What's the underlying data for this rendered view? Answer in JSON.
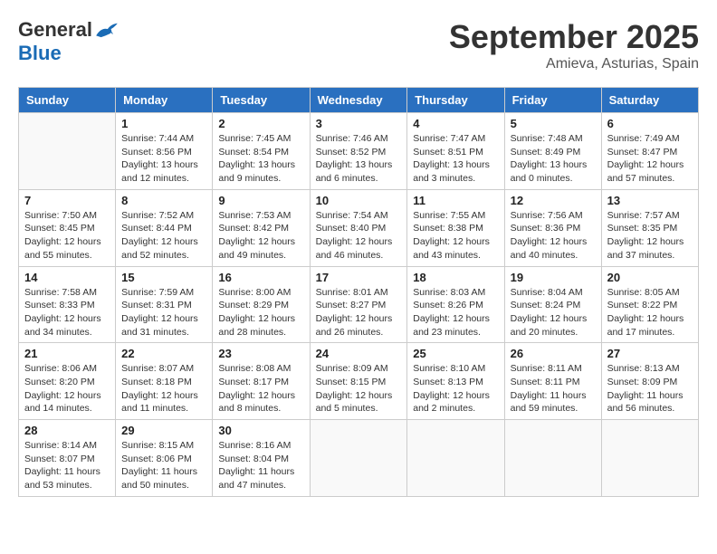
{
  "logo": {
    "general": "General",
    "blue": "Blue"
  },
  "title": "September 2025",
  "subtitle": "Amieva, Asturias, Spain",
  "weekdays": [
    "Sunday",
    "Monday",
    "Tuesday",
    "Wednesday",
    "Thursday",
    "Friday",
    "Saturday"
  ],
  "weeks": [
    [
      {
        "day": "",
        "sunrise": "",
        "sunset": "",
        "daylight": ""
      },
      {
        "day": "1",
        "sunrise": "Sunrise: 7:44 AM",
        "sunset": "Sunset: 8:56 PM",
        "daylight": "Daylight: 13 hours and 12 minutes."
      },
      {
        "day": "2",
        "sunrise": "Sunrise: 7:45 AM",
        "sunset": "Sunset: 8:54 PM",
        "daylight": "Daylight: 13 hours and 9 minutes."
      },
      {
        "day": "3",
        "sunrise": "Sunrise: 7:46 AM",
        "sunset": "Sunset: 8:52 PM",
        "daylight": "Daylight: 13 hours and 6 minutes."
      },
      {
        "day": "4",
        "sunrise": "Sunrise: 7:47 AM",
        "sunset": "Sunset: 8:51 PM",
        "daylight": "Daylight: 13 hours and 3 minutes."
      },
      {
        "day": "5",
        "sunrise": "Sunrise: 7:48 AM",
        "sunset": "Sunset: 8:49 PM",
        "daylight": "Daylight: 13 hours and 0 minutes."
      },
      {
        "day": "6",
        "sunrise": "Sunrise: 7:49 AM",
        "sunset": "Sunset: 8:47 PM",
        "daylight": "Daylight: 12 hours and 57 minutes."
      }
    ],
    [
      {
        "day": "7",
        "sunrise": "Sunrise: 7:50 AM",
        "sunset": "Sunset: 8:45 PM",
        "daylight": "Daylight: 12 hours and 55 minutes."
      },
      {
        "day": "8",
        "sunrise": "Sunrise: 7:52 AM",
        "sunset": "Sunset: 8:44 PM",
        "daylight": "Daylight: 12 hours and 52 minutes."
      },
      {
        "day": "9",
        "sunrise": "Sunrise: 7:53 AM",
        "sunset": "Sunset: 8:42 PM",
        "daylight": "Daylight: 12 hours and 49 minutes."
      },
      {
        "day": "10",
        "sunrise": "Sunrise: 7:54 AM",
        "sunset": "Sunset: 8:40 PM",
        "daylight": "Daylight: 12 hours and 46 minutes."
      },
      {
        "day": "11",
        "sunrise": "Sunrise: 7:55 AM",
        "sunset": "Sunset: 8:38 PM",
        "daylight": "Daylight: 12 hours and 43 minutes."
      },
      {
        "day": "12",
        "sunrise": "Sunrise: 7:56 AM",
        "sunset": "Sunset: 8:36 PM",
        "daylight": "Daylight: 12 hours and 40 minutes."
      },
      {
        "day": "13",
        "sunrise": "Sunrise: 7:57 AM",
        "sunset": "Sunset: 8:35 PM",
        "daylight": "Daylight: 12 hours and 37 minutes."
      }
    ],
    [
      {
        "day": "14",
        "sunrise": "Sunrise: 7:58 AM",
        "sunset": "Sunset: 8:33 PM",
        "daylight": "Daylight: 12 hours and 34 minutes."
      },
      {
        "day": "15",
        "sunrise": "Sunrise: 7:59 AM",
        "sunset": "Sunset: 8:31 PM",
        "daylight": "Daylight: 12 hours and 31 minutes."
      },
      {
        "day": "16",
        "sunrise": "Sunrise: 8:00 AM",
        "sunset": "Sunset: 8:29 PM",
        "daylight": "Daylight: 12 hours and 28 minutes."
      },
      {
        "day": "17",
        "sunrise": "Sunrise: 8:01 AM",
        "sunset": "Sunset: 8:27 PM",
        "daylight": "Daylight: 12 hours and 26 minutes."
      },
      {
        "day": "18",
        "sunrise": "Sunrise: 8:03 AM",
        "sunset": "Sunset: 8:26 PM",
        "daylight": "Daylight: 12 hours and 23 minutes."
      },
      {
        "day": "19",
        "sunrise": "Sunrise: 8:04 AM",
        "sunset": "Sunset: 8:24 PM",
        "daylight": "Daylight: 12 hours and 20 minutes."
      },
      {
        "day": "20",
        "sunrise": "Sunrise: 8:05 AM",
        "sunset": "Sunset: 8:22 PM",
        "daylight": "Daylight: 12 hours and 17 minutes."
      }
    ],
    [
      {
        "day": "21",
        "sunrise": "Sunrise: 8:06 AM",
        "sunset": "Sunset: 8:20 PM",
        "daylight": "Daylight: 12 hours and 14 minutes."
      },
      {
        "day": "22",
        "sunrise": "Sunrise: 8:07 AM",
        "sunset": "Sunset: 8:18 PM",
        "daylight": "Daylight: 12 hours and 11 minutes."
      },
      {
        "day": "23",
        "sunrise": "Sunrise: 8:08 AM",
        "sunset": "Sunset: 8:17 PM",
        "daylight": "Daylight: 12 hours and 8 minutes."
      },
      {
        "day": "24",
        "sunrise": "Sunrise: 8:09 AM",
        "sunset": "Sunset: 8:15 PM",
        "daylight": "Daylight: 12 hours and 5 minutes."
      },
      {
        "day": "25",
        "sunrise": "Sunrise: 8:10 AM",
        "sunset": "Sunset: 8:13 PM",
        "daylight": "Daylight: 12 hours and 2 minutes."
      },
      {
        "day": "26",
        "sunrise": "Sunrise: 8:11 AM",
        "sunset": "Sunset: 8:11 PM",
        "daylight": "Daylight: 11 hours and 59 minutes."
      },
      {
        "day": "27",
        "sunrise": "Sunrise: 8:13 AM",
        "sunset": "Sunset: 8:09 PM",
        "daylight": "Daylight: 11 hours and 56 minutes."
      }
    ],
    [
      {
        "day": "28",
        "sunrise": "Sunrise: 8:14 AM",
        "sunset": "Sunset: 8:07 PM",
        "daylight": "Daylight: 11 hours and 53 minutes."
      },
      {
        "day": "29",
        "sunrise": "Sunrise: 8:15 AM",
        "sunset": "Sunset: 8:06 PM",
        "daylight": "Daylight: 11 hours and 50 minutes."
      },
      {
        "day": "30",
        "sunrise": "Sunrise: 8:16 AM",
        "sunset": "Sunset: 8:04 PM",
        "daylight": "Daylight: 11 hours and 47 minutes."
      },
      {
        "day": "",
        "sunrise": "",
        "sunset": "",
        "daylight": ""
      },
      {
        "day": "",
        "sunrise": "",
        "sunset": "",
        "daylight": ""
      },
      {
        "day": "",
        "sunrise": "",
        "sunset": "",
        "daylight": ""
      },
      {
        "day": "",
        "sunrise": "",
        "sunset": "",
        "daylight": ""
      }
    ]
  ]
}
